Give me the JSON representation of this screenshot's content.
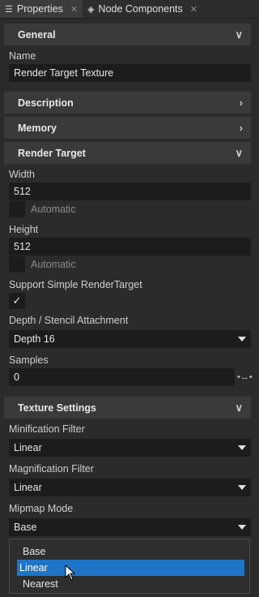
{
  "tabs": [
    {
      "label": "Properties",
      "icon": "sliders-icon"
    },
    {
      "label": "Node Components",
      "icon": "node-components-icon"
    }
  ],
  "sections": {
    "general": "General",
    "description": "Description",
    "memory": "Memory",
    "render_target": "Render Target",
    "texture_settings": "Texture Settings"
  },
  "name": {
    "label": "Name",
    "value": "Render Target Texture"
  },
  "width": {
    "label": "Width",
    "value": "512",
    "automatic": "Automatic"
  },
  "height": {
    "label": "Height",
    "value": "512",
    "automatic": "Automatic"
  },
  "support_simple": {
    "label": "Support Simple RenderTarget",
    "checked": true
  },
  "depth": {
    "label": "Depth / Stencil Attachment",
    "value": "Depth 16"
  },
  "samples": {
    "label": "Samples",
    "value": "0"
  },
  "min_filter": {
    "label": "Minification Filter",
    "value": "Linear"
  },
  "mag_filter": {
    "label": "Magnification Filter",
    "value": "Linear"
  },
  "mipmap": {
    "label": "Mipmap Mode",
    "value": "Base"
  },
  "mipmap_options": [
    "Base",
    "Linear",
    "Nearest"
  ],
  "highlighted_option": "Linear",
  "colors": {
    "accent": "#1e74c6",
    "panel": "#2b2b2b",
    "header": "#3a3a3a",
    "field": "#1c1c1c"
  }
}
